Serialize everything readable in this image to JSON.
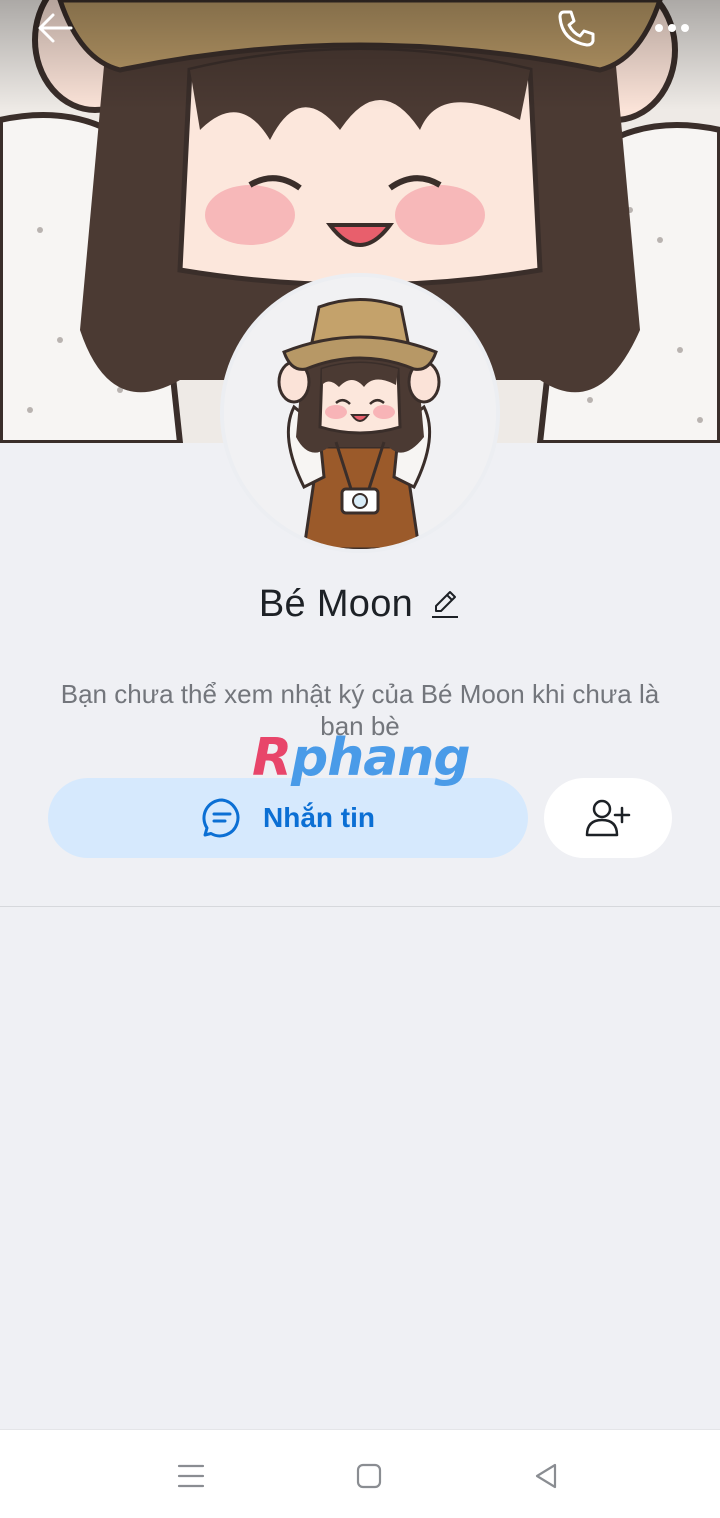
{
  "profile": {
    "name": "Bé Moon",
    "note": "Bạn chưa thể xem nhật ký của Bé Moon khi chưa là bạn bè"
  },
  "actions": {
    "message_label": "Nhắn tin"
  },
  "watermark": {
    "first": "R",
    "rest": "phang"
  },
  "icons": {
    "back": "arrow-left-icon",
    "call": "phone-icon",
    "more": "more-dots-icon",
    "edit": "pencil-icon",
    "message": "chat-bubble-icon",
    "add_friend": "user-plus-icon",
    "nav_menu": "menu-lines-icon",
    "nav_home": "home-square-icon",
    "nav_back": "triangle-back-icon"
  },
  "colors": {
    "accent": "#0b6fd4",
    "message_button_bg": "#d6e9fd",
    "page_bg": "#eff0f4"
  }
}
